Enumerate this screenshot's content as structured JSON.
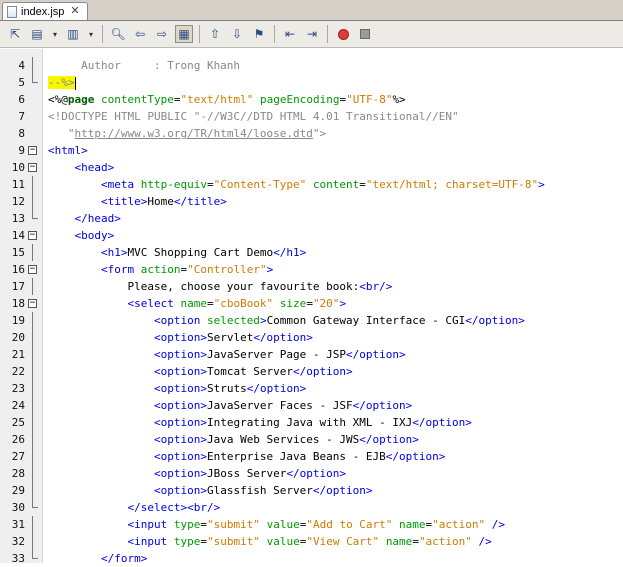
{
  "tab": {
    "filename": "index.jsp",
    "close_glyph": "✕"
  },
  "toolbar": {
    "buttons": [
      "last-edit-icon",
      "back-icon",
      "forward-icon",
      "find-icon",
      "find-previous-icon",
      "find-next-icon",
      "toggle-highlight-icon",
      "previous-bookmark-icon",
      "next-bookmark-icon",
      "toggle-bookmark-icon",
      "shift-left-icon",
      "shift-right-icon",
      "start-macro-icon",
      "stop-macro-icon"
    ]
  },
  "editor": {
    "lines": [
      {
        "n": "4",
        "fold": "line",
        "tokens": [
          {
            "t": "     Author     : Trong Khanh",
            "c": "c-cmt"
          }
        ]
      },
      {
        "n": "5",
        "fold": "end",
        "tokens": [
          {
            "t": "--%>",
            "c": "c-cmt hl"
          }
        ],
        "caret": true
      },
      {
        "n": "6",
        "fold": "",
        "tokens": [
          {
            "t": "<%@",
            "c": "c-dir"
          },
          {
            "t": "page",
            "c": "c-dirkw"
          },
          {
            "t": " ",
            "c": "c-text"
          },
          {
            "t": "contentType",
            "c": "c-attr"
          },
          {
            "t": "=",
            "c": "c-text"
          },
          {
            "t": "\"text/html\"",
            "c": "c-val"
          },
          {
            "t": " ",
            "c": "c-text"
          },
          {
            "t": "pageEncoding",
            "c": "c-attr"
          },
          {
            "t": "=",
            "c": "c-text"
          },
          {
            "t": "\"UTF-8\"",
            "c": "c-val"
          },
          {
            "t": "%>",
            "c": "c-dir"
          }
        ]
      },
      {
        "n": "7",
        "fold": "",
        "tokens": [
          {
            "t": "<!DOCTYPE HTML PUBLIC \"-//W3C//DTD HTML 4.01 Transitional//EN\"",
            "c": "c-doc"
          }
        ]
      },
      {
        "n": "8",
        "fold": "",
        "tokens": [
          {
            "t": "   \"",
            "c": "c-doc"
          },
          {
            "t": "http://www.w3.org/TR/html4/loose.dtd",
            "c": "c-url"
          },
          {
            "t": "\">",
            "c": "c-doc"
          }
        ]
      },
      {
        "n": "9",
        "fold": "box",
        "tokens": [
          {
            "t": "<html>",
            "c": "c-tag"
          }
        ]
      },
      {
        "n": "10",
        "fold": "box",
        "tokens": [
          {
            "t": "    <head>",
            "c": "c-tag"
          }
        ]
      },
      {
        "n": "11",
        "fold": "line",
        "tokens": [
          {
            "t": "        <meta ",
            "c": "c-tag"
          },
          {
            "t": "http-equiv",
            "c": "c-attr"
          },
          {
            "t": "=",
            "c": "c-text"
          },
          {
            "t": "\"Content-Type\"",
            "c": "c-val"
          },
          {
            "t": " ",
            "c": "c-text"
          },
          {
            "t": "content",
            "c": "c-attr"
          },
          {
            "t": "=",
            "c": "c-text"
          },
          {
            "t": "\"text/html; charset=UTF-8\"",
            "c": "c-val"
          },
          {
            "t": ">",
            "c": "c-tag"
          }
        ]
      },
      {
        "n": "12",
        "fold": "line",
        "tokens": [
          {
            "t": "        <title>",
            "c": "c-tag"
          },
          {
            "t": "Home",
            "c": "c-text"
          },
          {
            "t": "</title>",
            "c": "c-tag"
          }
        ]
      },
      {
        "n": "13",
        "fold": "end",
        "tokens": [
          {
            "t": "    </head>",
            "c": "c-tag"
          }
        ]
      },
      {
        "n": "14",
        "fold": "box",
        "tokens": [
          {
            "t": "    <body>",
            "c": "c-tag"
          }
        ]
      },
      {
        "n": "15",
        "fold": "line",
        "tokens": [
          {
            "t": "        <h1>",
            "c": "c-tag"
          },
          {
            "t": "MVC Shopping Cart Demo",
            "c": "c-text"
          },
          {
            "t": "</h1>",
            "c": "c-tag"
          }
        ]
      },
      {
        "n": "16",
        "fold": "box",
        "tokens": [
          {
            "t": "        <form ",
            "c": "c-tag"
          },
          {
            "t": "action",
            "c": "c-attr"
          },
          {
            "t": "=",
            "c": "c-text"
          },
          {
            "t": "\"Controller\"",
            "c": "c-val"
          },
          {
            "t": ">",
            "c": "c-tag"
          }
        ]
      },
      {
        "n": "17",
        "fold": "line",
        "tokens": [
          {
            "t": "            Please, choose your favourite book:",
            "c": "c-text"
          },
          {
            "t": "<br/>",
            "c": "c-tag"
          }
        ]
      },
      {
        "n": "18",
        "fold": "box",
        "tokens": [
          {
            "t": "            <select ",
            "c": "c-tag"
          },
          {
            "t": "name",
            "c": "c-attr"
          },
          {
            "t": "=",
            "c": "c-text"
          },
          {
            "t": "\"cboBook\"",
            "c": "c-val"
          },
          {
            "t": " ",
            "c": "c-text"
          },
          {
            "t": "size",
            "c": "c-attr"
          },
          {
            "t": "=",
            "c": "c-text"
          },
          {
            "t": "\"20\"",
            "c": "c-val"
          },
          {
            "t": ">",
            "c": "c-tag"
          }
        ]
      },
      {
        "n": "19",
        "fold": "line",
        "tokens": [
          {
            "t": "                <option ",
            "c": "c-tag"
          },
          {
            "t": "selected",
            "c": "c-attr"
          },
          {
            "t": ">",
            "c": "c-tag"
          },
          {
            "t": "Common Gateway Interface - CGI",
            "c": "c-text"
          },
          {
            "t": "</option>",
            "c": "c-tag"
          }
        ]
      },
      {
        "n": "20",
        "fold": "line",
        "tokens": [
          {
            "t": "                <option>",
            "c": "c-tag"
          },
          {
            "t": "Servlet",
            "c": "c-text"
          },
          {
            "t": "</option>",
            "c": "c-tag"
          }
        ]
      },
      {
        "n": "21",
        "fold": "line",
        "tokens": [
          {
            "t": "                <option>",
            "c": "c-tag"
          },
          {
            "t": "JavaServer Page - JSP",
            "c": "c-text"
          },
          {
            "t": "</option>",
            "c": "c-tag"
          }
        ]
      },
      {
        "n": "22",
        "fold": "line",
        "tokens": [
          {
            "t": "                <option>",
            "c": "c-tag"
          },
          {
            "t": "Tomcat Server",
            "c": "c-text"
          },
          {
            "t": "</option>",
            "c": "c-tag"
          }
        ]
      },
      {
        "n": "23",
        "fold": "line",
        "tokens": [
          {
            "t": "                <option>",
            "c": "c-tag"
          },
          {
            "t": "Struts",
            "c": "c-text"
          },
          {
            "t": "</option>",
            "c": "c-tag"
          }
        ]
      },
      {
        "n": "24",
        "fold": "line",
        "tokens": [
          {
            "t": "                <option>",
            "c": "c-tag"
          },
          {
            "t": "JavaServer Faces - JSF",
            "c": "c-text"
          },
          {
            "t": "</option>",
            "c": "c-tag"
          }
        ]
      },
      {
        "n": "25",
        "fold": "line",
        "tokens": [
          {
            "t": "                <option>",
            "c": "c-tag"
          },
          {
            "t": "Integrating Java with XML - IXJ",
            "c": "c-text"
          },
          {
            "t": "</option>",
            "c": "c-tag"
          }
        ]
      },
      {
        "n": "26",
        "fold": "line",
        "tokens": [
          {
            "t": "                <option>",
            "c": "c-tag"
          },
          {
            "t": "Java Web Services - JWS",
            "c": "c-text"
          },
          {
            "t": "</option>",
            "c": "c-tag"
          }
        ]
      },
      {
        "n": "27",
        "fold": "line",
        "tokens": [
          {
            "t": "                <option>",
            "c": "c-tag"
          },
          {
            "t": "Enterprise Java Beans - EJB",
            "c": "c-text"
          },
          {
            "t": "</option>",
            "c": "c-tag"
          }
        ]
      },
      {
        "n": "28",
        "fold": "line",
        "tokens": [
          {
            "t": "                <option>",
            "c": "c-tag"
          },
          {
            "t": "JBoss Server",
            "c": "c-text"
          },
          {
            "t": "</option>",
            "c": "c-tag"
          }
        ]
      },
      {
        "n": "29",
        "fold": "line",
        "tokens": [
          {
            "t": "                <option>",
            "c": "c-tag"
          },
          {
            "t": "Glassfish Server",
            "c": "c-text"
          },
          {
            "t": "</option>",
            "c": "c-tag"
          }
        ]
      },
      {
        "n": "30",
        "fold": "end",
        "tokens": [
          {
            "t": "            </select>",
            "c": "c-tag"
          },
          {
            "t": "<br/>",
            "c": "c-tag"
          }
        ]
      },
      {
        "n": "31",
        "fold": "line",
        "tokens": [
          {
            "t": "            <input ",
            "c": "c-tag"
          },
          {
            "t": "type",
            "c": "c-attr"
          },
          {
            "t": "=",
            "c": "c-text"
          },
          {
            "t": "\"submit\"",
            "c": "c-val"
          },
          {
            "t": " ",
            "c": "c-text"
          },
          {
            "t": "value",
            "c": "c-attr"
          },
          {
            "t": "=",
            "c": "c-text"
          },
          {
            "t": "\"Add to Cart\"",
            "c": "c-val"
          },
          {
            "t": " ",
            "c": "c-text"
          },
          {
            "t": "name",
            "c": "c-attr"
          },
          {
            "t": "=",
            "c": "c-text"
          },
          {
            "t": "\"action\"",
            "c": "c-val"
          },
          {
            "t": " />",
            "c": "c-tag"
          }
        ]
      },
      {
        "n": "32",
        "fold": "line",
        "tokens": [
          {
            "t": "            <input ",
            "c": "c-tag"
          },
          {
            "t": "type",
            "c": "c-attr"
          },
          {
            "t": "=",
            "c": "c-text"
          },
          {
            "t": "\"submit\"",
            "c": "c-val"
          },
          {
            "t": " ",
            "c": "c-text"
          },
          {
            "t": "value",
            "c": "c-attr"
          },
          {
            "t": "=",
            "c": "c-text"
          },
          {
            "t": "\"View Cart\"",
            "c": "c-val"
          },
          {
            "t": " ",
            "c": "c-text"
          },
          {
            "t": "name",
            "c": "c-attr"
          },
          {
            "t": "=",
            "c": "c-text"
          },
          {
            "t": "\"action\"",
            "c": "c-val"
          },
          {
            "t": " />",
            "c": "c-tag"
          }
        ]
      },
      {
        "n": "33",
        "fold": "end",
        "tokens": [
          {
            "t": "        </form>",
            "c": "c-tag"
          }
        ]
      }
    ]
  }
}
